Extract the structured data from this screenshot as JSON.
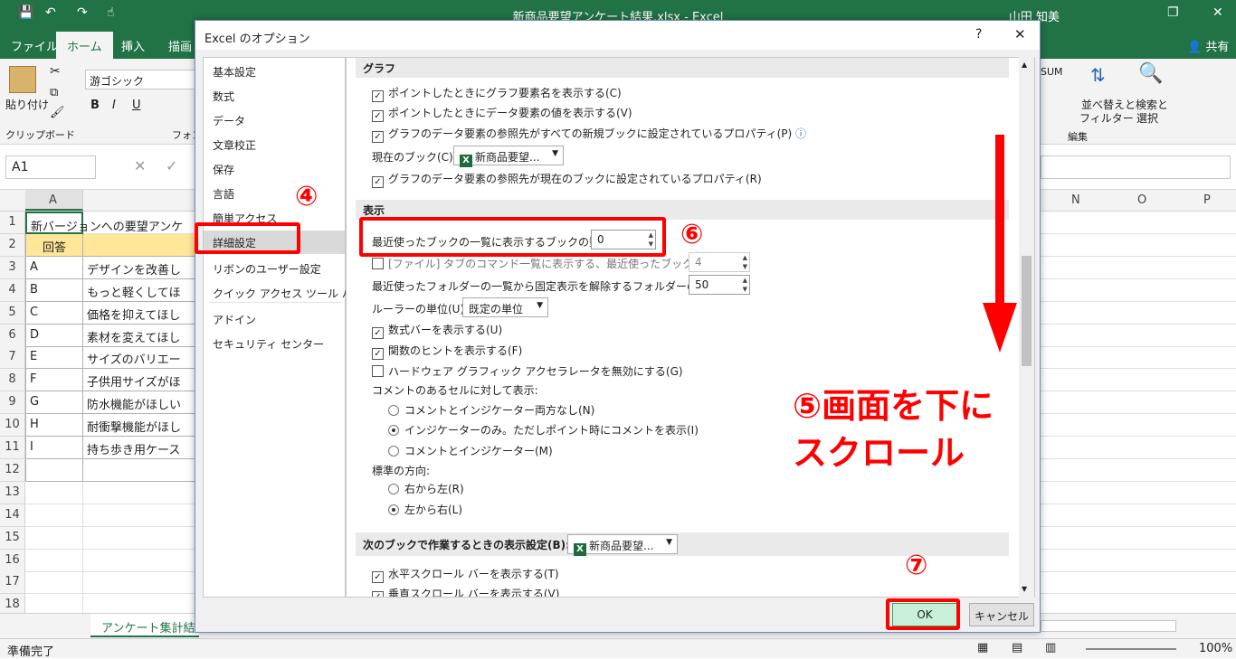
{
  "excel": {
    "title": "新商品要望アンケート結果.xlsx  -  Excel",
    "user": "山田 知美",
    "share": "共有",
    "tabs": [
      "ファイル",
      "ホーム",
      "挿入",
      "描画"
    ],
    "font_name": "游ゴシック",
    "paste_label": "貼り付け",
    "clipboard_label": "クリップボード",
    "font_group_label": "フォン",
    "sum_label": "SUM",
    "sort_label_1": "並べ替えと",
    "sort_label_2": "フィルター",
    "find_label_1": "検索と",
    "find_label_2": "選択",
    "edit_group_label": "編集",
    "namebox": "A1",
    "columns_left": [
      "A"
    ],
    "columns_right": [
      "N",
      "O",
      "P"
    ],
    "rows": [
      {
        "num": "1",
        "a": "新バージョンへの要望アンケ",
        "b": ""
      },
      {
        "num": "2",
        "a": "回答",
        "b": ""
      },
      {
        "num": "3",
        "a": "A",
        "b": "デザインを改善し"
      },
      {
        "num": "4",
        "a": "B",
        "b": "もっと軽くしてほ"
      },
      {
        "num": "5",
        "a": "C",
        "b": "価格を抑えてほし"
      },
      {
        "num": "6",
        "a": "D",
        "b": "素材を変えてほし"
      },
      {
        "num": "7",
        "a": "E",
        "b": "サイズのバリエー"
      },
      {
        "num": "8",
        "a": "F",
        "b": "子供用サイズがほ"
      },
      {
        "num": "9",
        "a": "G",
        "b": "防水機能がほしい"
      },
      {
        "num": "10",
        "a": "H",
        "b": "耐衝撃機能がほし"
      },
      {
        "num": "11",
        "a": "I",
        "b": "持ち歩き用ケース"
      },
      {
        "num": "12",
        "a": "",
        "b": ""
      },
      {
        "num": "13",
        "a": "",
        "b": ""
      },
      {
        "num": "14",
        "a": "",
        "b": ""
      },
      {
        "num": "15",
        "a": "",
        "b": ""
      },
      {
        "num": "16",
        "a": "",
        "b": ""
      },
      {
        "num": "17",
        "a": "",
        "b": ""
      },
      {
        "num": "18",
        "a": "",
        "b": ""
      }
    ],
    "sheet_tab": "アンケート集計結果",
    "status": "準備完了",
    "zoom": "100%"
  },
  "dialog": {
    "title": "Excel のオプション",
    "help": "?",
    "close": "✕",
    "nav": [
      "基本設定",
      "数式",
      "データ",
      "文章校正",
      "保存",
      "言語",
      "簡単アクセス",
      "詳細設定",
      "リボンのユーザー設定",
      "クイック アクセス ツール バー",
      "アドイン",
      "セキュリティ センター"
    ],
    "graph_section": "グラフ",
    "graph_opts": [
      "ポイントしたときにグラフ要素名を表示する(C)",
      "ポイントしたときにデータ要素の値を表示する(V)",
      "グラフのデータ要素の参照先がすべての新規ブックに設定されているプロパティ(P)"
    ],
    "current_book_label": "現在のブック(C):",
    "current_book_value": "新商品要望...",
    "graph_opt4": "グラフのデータ要素の参照先が現在のブックに設定されているプロパティ(R)",
    "display_section": "表示",
    "recent_books_label": "最近使ったブックの一覧に表示するブックの数(R):",
    "recent_books_value": "0",
    "file_tab_label": "[ファイル] タブのコマンド一覧に表示する、最近使ったブックの数(Q):",
    "file_tab_value": "4",
    "recent_folders_label": "最近使ったフォルダーの一覧から固定表示を解除するフォルダーの数(F):",
    "recent_folders_value": "50",
    "ruler_label": "ルーラーの単位(U)",
    "ruler_value": "既定の単位",
    "show_formula_bar": "数式バーを表示する(U)",
    "show_func_tips": "関数のヒントを表示する(F)",
    "disable_hw": "ハードウェア グラフィック アクセラレータを無効にする(G)",
    "comment_label": "コメントのあるセルに対して表示:",
    "comment_opts": [
      "コメントとインジケーター両方なし(N)",
      "インジケーターのみ。ただしポイント時にコメントを表示(I)",
      "コメントとインジケーター(M)"
    ],
    "direction_label": "標準の方向:",
    "direction_opts": [
      "右から左(R)",
      "左から右(L)"
    ],
    "next_book_section": "次のブックで作業するときの表示設定(B):",
    "next_book_value": "新商品要望...",
    "hscroll_opt": "水平スクロール バーを表示する(T)",
    "vscroll_opt": "垂直スクロール バーを表示する(V)",
    "ok": "OK",
    "cancel": "キャンセル"
  },
  "annotations": {
    "n4": "④",
    "n6": "⑥",
    "n7": "⑦",
    "line1": "⑤画面を下に",
    "line2": "スクロール"
  },
  "colors": {
    "excel_green": "#217346",
    "annotation_red": "#ff0000",
    "ok_green": "#c8efd8"
  }
}
